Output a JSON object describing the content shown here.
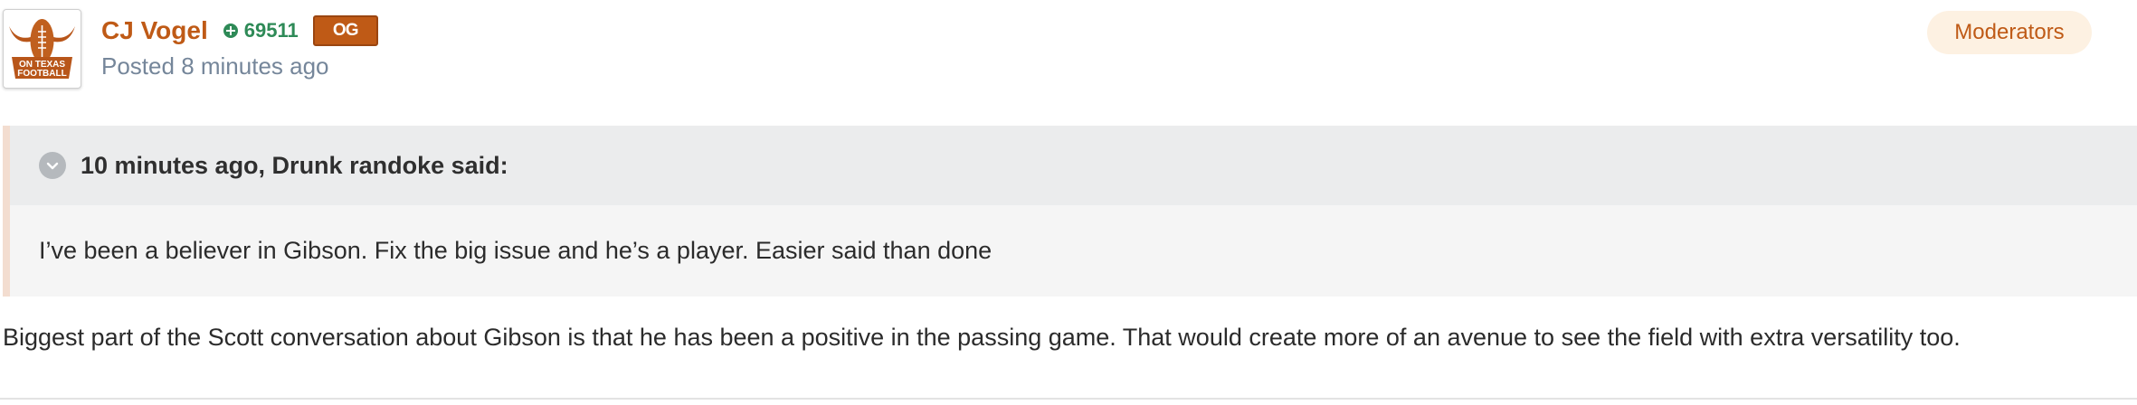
{
  "author": {
    "name": "CJ Vogel",
    "reputation": "69511",
    "badge_label": "OG",
    "avatar_text_line1": "ON TEXAS",
    "avatar_text_line2": "FOOTBALL",
    "group": "Moderators"
  },
  "meta": {
    "posted_prefix": "Posted",
    "posted_time": "8 minutes ago"
  },
  "quote": {
    "citation": "10 minutes ago, Drunk randoke said:",
    "text": "I’ve been a believer in Gibson. Fix the big issue and he’s a player. Easier said than done"
  },
  "body": {
    "text": "Biggest part of the Scott conversation about Gibson is that he has been a positive in the passing game. That would create more of an avenue to see the field with extra versatility too."
  },
  "colors": {
    "accent": "#bf5a16",
    "reputation": "#2e8a57",
    "meta": "#75869a",
    "group_badge_bg": "#fdf1e2",
    "quote_bg": "#f5f5f5",
    "quote_header_bg": "#ebeced"
  },
  "icons": {
    "reputation": "plus-circle-icon",
    "quote_toggle": "chevron-down-icon"
  }
}
